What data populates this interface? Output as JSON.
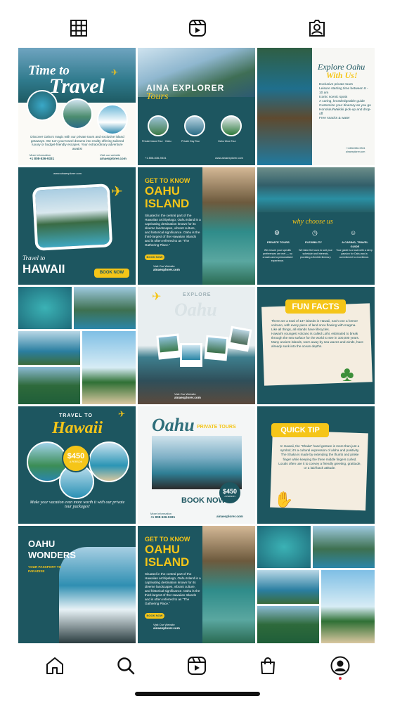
{
  "tabs": {
    "grid": "grid-icon",
    "reels": "reels-icon",
    "tagged": "tagged-icon"
  },
  "colors": {
    "teal": "#1d5660",
    "yellow": "#f5c518",
    "cream": "#f4ede0"
  },
  "posts": {
    "p1": {
      "title1": "Time to",
      "title2": "Travel",
      "body": "Discover Oahu's magic with our private tours and exclusive island getaways. We turn your travel dreams into reality offering tailored luxury or budget-friendly escapes. Your extraordinary adventure awaits!",
      "info_label": "More information",
      "phone": "+1 808-536-9331",
      "web_label": "Visit our website",
      "website": "ainaexplorer.com"
    },
    "p2": {
      "title1": "AINA EXPLORER",
      "title2": "Tours",
      "cap1": "Private Island Tour · Oahu",
      "cap2": "Private Day Tour",
      "cap3": "Oahu Wow Tour",
      "phone": "+1 808-536-9331",
      "website": "www.ainaexplorer.com"
    },
    "p3": {
      "title1": "Explore Oahu",
      "title2": "With Us!",
      "items": [
        "Exclusive private tours",
        "Leisure starting time between 8 - 10 am",
        "Iconic scenic spots",
        "A caring, knowledgeable guide",
        "Customize your itinerary as you go",
        "Honolulu/Waikiki pick-up and drop-off",
        "Free snacks & water"
      ],
      "phone": "+1 808-536-9331",
      "website": "ainaexplorer.com"
    },
    "p4": {
      "website": "www.ainaexplorer.com",
      "title1": "Travel to",
      "title2": "HAWAII",
      "button": "BOOK NOW"
    },
    "p5": {
      "title1": "GET TO KNOW",
      "title2": "OAHU",
      "title3": "ISLAND",
      "body": "Situated in the central part of the Hawaiian archipelago, Oahu Island is a captivating destination known for its diverse landscapes, vibrant culture, and historical significance. Oahu is the third-largest of the Hawaiian Islands and is often referred to as \"The Gathering Place.\"",
      "button": "BOOK NOW",
      "web_label": "Visit Our Website",
      "website": "ainaexplorer.com"
    },
    "p6": {
      "title": "why choose us",
      "c1": "PRIVATE TOURS",
      "c2": "FLEXIBILITY",
      "c3": "A CARING, TRAVEL GUIDE",
      "t1": "We ensure your specific preferences are met — no crowds and a personalized experience.",
      "t2": "We tailor the tours to suit your schedule and interests, providing a flexible itinerary.",
      "t3": "Your guide is a local with a deep passion for Oahu and a commitment to excellence."
    },
    "p8": {
      "title1": "EXPLORE",
      "title2": "Oahu",
      "web_label": "Visit Our Website",
      "website": "ainaexplorer.com"
    },
    "p9": {
      "title": "FUN FACTS",
      "facts": [
        "There are a total of 137 islands in Hawaii, each one a former volcano, with every piece of land once flowing with magma.",
        "Like all things, all islands have lifecycles.",
        "Hawaii's youngest volcano is called Loihi, estimated to break through the sea surface for the world to see in 100,000 years.",
        "Many ancient islands, worn away by sea waves and winds, have already sunk into the ocean depths."
      ]
    },
    "p10": {
      "title1": "TRAVEL TO",
      "title2": "Hawaii",
      "price": "$450",
      "per": "A PERSON",
      "tagline": "Make your vacation even more worth it with our private tour packages!"
    },
    "p11": {
      "title1": "Oahu",
      "title2": "PRIVATE TOURS",
      "price": "$450",
      "per": "A PERSON",
      "button": "BOOK NOW",
      "info_label": "More information",
      "phone": "+1 808-536-9331",
      "website": "ainaexplorer.com"
    },
    "p12": {
      "title": "QUICK TIP",
      "body": "In Hawaii, the \"Shaka\" hand gesture is more than just a symbol; it's a cultural expression of aloha and positivity. The Shaka is made by extending the thumb and pinkie finger while keeping the three middle fingers curled. Locals often use it to convey a friendly greeting, gratitude, or a laid-back attitude."
    },
    "p13": {
      "title1": "OAHU",
      "title2": "WONDERS",
      "sub1": "YOUR PASSPORT TO",
      "sub2": "PARADISE"
    },
    "p14": {
      "title1": "GET TO KNOW",
      "title2": "OAHU",
      "title3": "ISLAND",
      "body": "Situated in the central part of the Hawaiian archipelago, Oahu Island is a captivating destination known for its diverse landscapes, vibrant culture, and historical significance. Oahu is the third-largest of the Hawaiian Islands and is often referred to as \"The Gathering Place.\"",
      "button": "BOOK NOW",
      "web_label": "Visit Our Website",
      "website": "ainaexplorer.com"
    }
  },
  "bottom_nav": {
    "home": "home-icon",
    "search": "search-icon",
    "reels": "reels-icon",
    "shop": "shop-icon",
    "profile": "profile-icon"
  }
}
